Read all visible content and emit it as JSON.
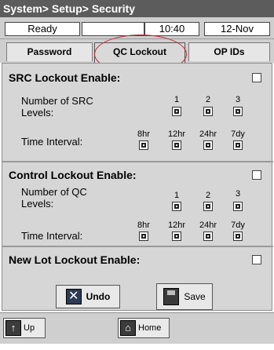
{
  "window": {
    "title": "System> Setup> Security"
  },
  "status": {
    "state": "Ready",
    "message": "",
    "time": "10:40",
    "date": "12-Nov"
  },
  "tabs": [
    {
      "label": "Password"
    },
    {
      "label": "QC Lockout",
      "active": true
    },
    {
      "label": "OP IDs"
    }
  ],
  "src_lockout": {
    "title": "SRC Lockout Enable:",
    "enabled": false,
    "levels_label": "Number of SRC Levels:",
    "levels": [
      "1",
      "2",
      "3"
    ],
    "interval_label": "Time Interval:",
    "intervals": [
      "8hr",
      "12hr",
      "24hr",
      "7dy"
    ]
  },
  "control_lockout": {
    "title": "Control Lockout Enable:",
    "enabled": false,
    "levels_label": "Number of QC Levels:",
    "levels": [
      "1",
      "2",
      "3"
    ],
    "interval_label": "Time Interval:",
    "intervals": [
      "8hr",
      "12hr",
      "24hr",
      "7dy"
    ]
  },
  "new_lot_lockout": {
    "title": "New Lot Lockout Enable:",
    "enabled": false
  },
  "actions": {
    "undo_label": "Undo",
    "save_label": "Save"
  },
  "nav": {
    "up_label": "Up",
    "home_label": "Home"
  },
  "colors": {
    "title_bg": "#5c5c5c",
    "panel_bg": "#d6d6d6",
    "highlight_ellipse": "#c0282f"
  }
}
